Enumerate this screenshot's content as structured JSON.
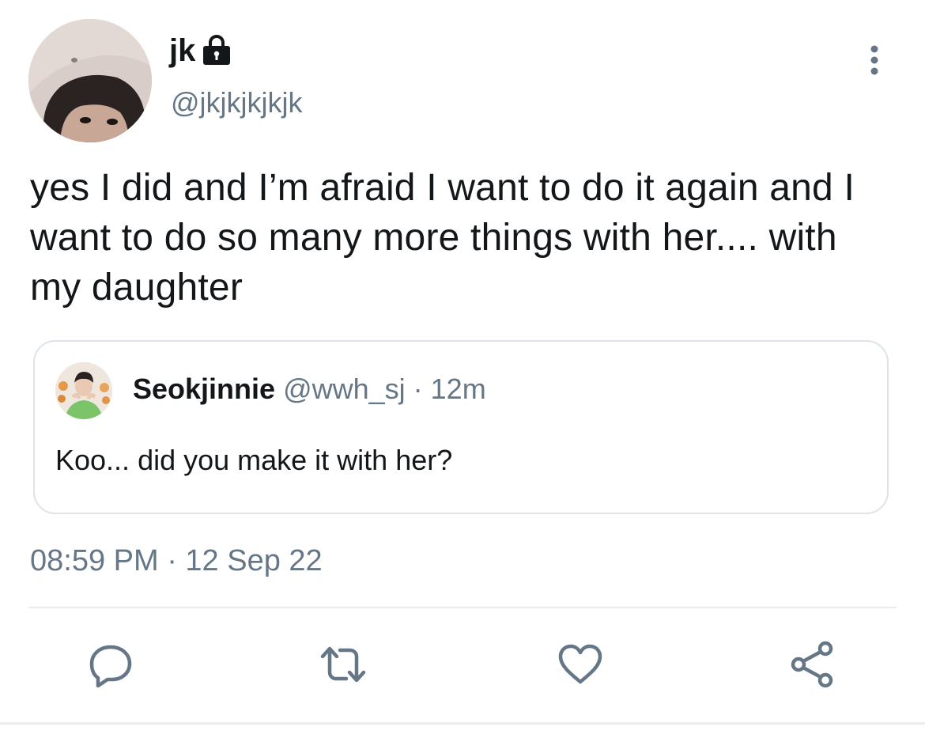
{
  "tweet": {
    "author_name": "jk",
    "author_handle": "@jkjkjkjkjk",
    "protected_icon": "lock-icon",
    "text": "yes I did and I’m afraid I want to do it again and I want to do so many more things with her.... with my daughter",
    "timestamp": "08:59 PM · 12 Sep 22"
  },
  "quoted_tweet": {
    "author_name": "Seokjinnie",
    "author_handle": "@wwh_sj",
    "meta": " · 12m",
    "text": "Koo... did you make it with her?"
  },
  "actions": {
    "reply_icon": "reply-icon",
    "retweet_icon": "retweet-icon",
    "like_icon": "heart-icon",
    "share_icon": "share-icon",
    "more_icon": "more-vertical-icon"
  },
  "colors": {
    "text": "#14171a",
    "secondary": "#657786",
    "border": "#dde3e8",
    "icon": "#657786"
  }
}
